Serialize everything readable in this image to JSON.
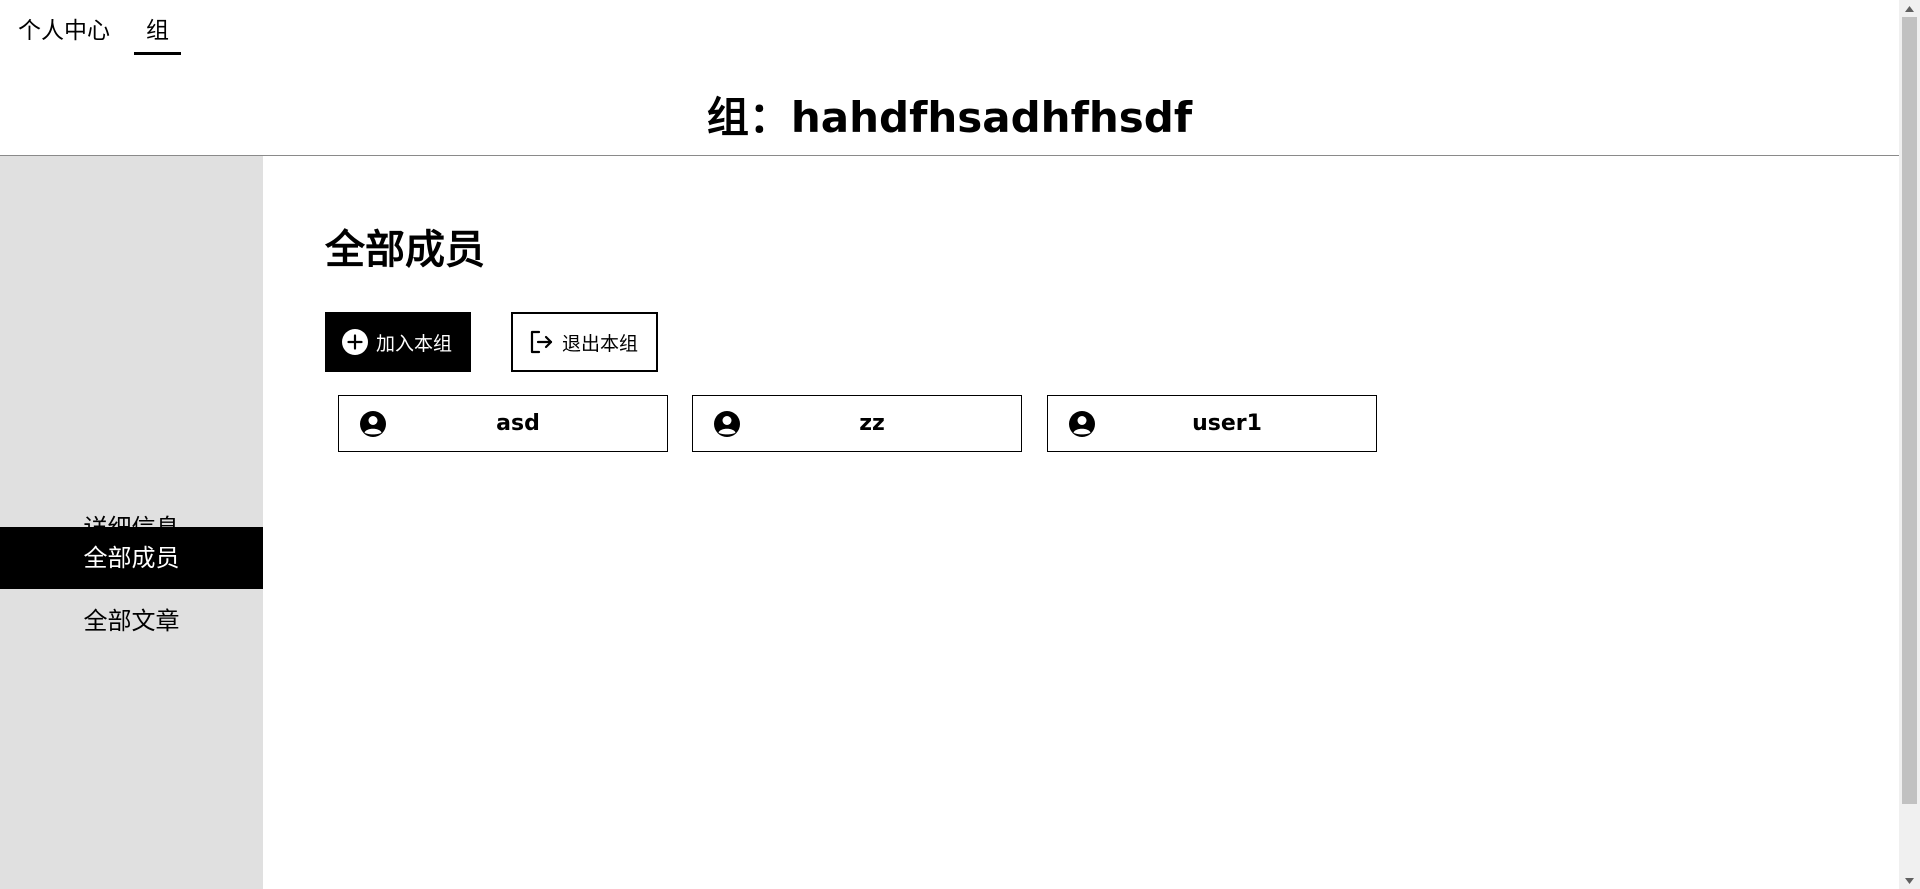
{
  "top_nav": {
    "tabs": [
      {
        "label": "个人中心"
      },
      {
        "label": "组",
        "active": true
      }
    ]
  },
  "header": {
    "title": "组：hahdfhsadhfhsdf"
  },
  "sidebar": {
    "items": [
      {
        "label": "详细信息"
      },
      {
        "label": "全部成员",
        "active": true
      },
      {
        "label": "全部文章"
      }
    ]
  },
  "main": {
    "section_title": "全部成员",
    "buttons": {
      "join": {
        "label": "加入本组",
        "icon": "plus-circle-icon"
      },
      "leave": {
        "label": "退出本组",
        "icon": "logout-icon"
      }
    },
    "members": [
      {
        "name": "asd",
        "icon": "user-avatar-icon"
      },
      {
        "name": "zz",
        "icon": "user-avatar-icon"
      },
      {
        "name": "user1",
        "icon": "user-avatar-icon"
      }
    ]
  },
  "colors": {
    "sidebar_bg": "#e0e0e0",
    "active_bg": "#000000",
    "active_text": "#ffffff"
  }
}
